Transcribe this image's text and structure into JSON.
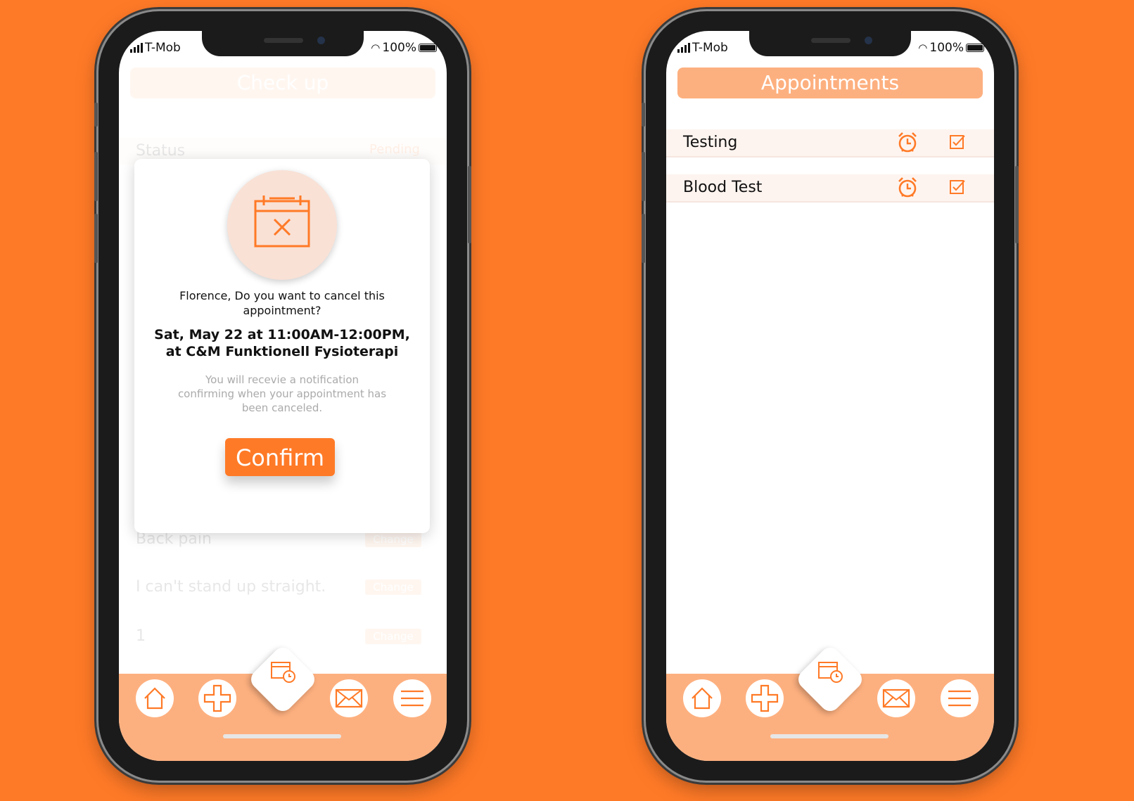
{
  "phone1": {
    "status": {
      "carrier": "T-Mob",
      "battery": "100%"
    },
    "header_title": "Check up",
    "background": {
      "status_label": "Status",
      "status_value": "Pending",
      "rows": [
        {
          "label": "Back pain",
          "action": "Change"
        },
        {
          "label": "I can't stand up straight.",
          "action": "Change"
        },
        {
          "label": "1",
          "action": "Change"
        }
      ]
    },
    "modal": {
      "question": "Florence, Do you want to cancel this appointment?",
      "when": "Sat, May 22 at 11:00AM-12:00PM, at C&M Funktionell Fysioterapi",
      "note": "You will recevie a notification confirming when your appointment has been canceled.",
      "confirm_label": "Confirm"
    }
  },
  "phone2": {
    "status": {
      "carrier": "T-Mob",
      "battery": "100%"
    },
    "header_title": "Appointments",
    "appointments": [
      {
        "label": "Testing"
      },
      {
        "label": "Blood Test"
      }
    ]
  },
  "tabbar": {
    "items": [
      "home-icon",
      "plus-icon",
      "calendar-clock-icon",
      "mail-icon",
      "menu-icon"
    ]
  },
  "colors": {
    "accent": "#FF7A27",
    "light_accent": "#FDB07F",
    "background": "#FF7A27"
  }
}
